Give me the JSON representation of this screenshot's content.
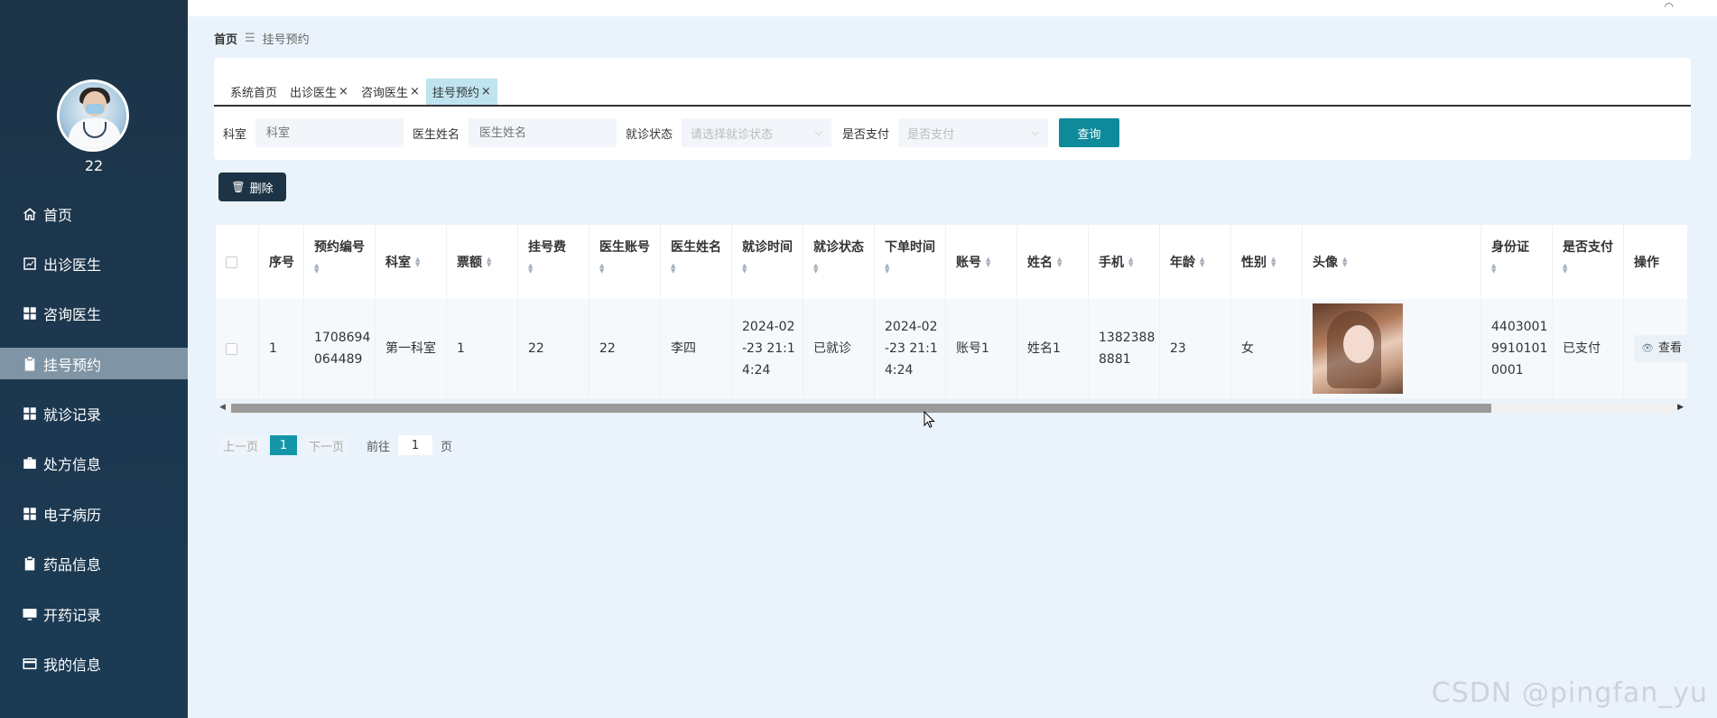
{
  "sidebar": {
    "username": "22",
    "items": [
      {
        "label": "首页",
        "icon": "home-icon"
      },
      {
        "label": "出诊医生",
        "icon": "chart-icon"
      },
      {
        "label": "咨询医生",
        "icon": "grid-icon"
      },
      {
        "label": "挂号预约",
        "icon": "clipboard-icon",
        "active": true
      },
      {
        "label": "就诊记录",
        "icon": "grid-icon"
      },
      {
        "label": "处方信息",
        "icon": "briefcase-icon"
      },
      {
        "label": "电子病历",
        "icon": "grid-icon"
      },
      {
        "label": "药品信息",
        "icon": "clipboard-icon"
      },
      {
        "label": "开药记录",
        "icon": "monitor-icon"
      },
      {
        "label": "我的信息",
        "icon": "card-icon"
      }
    ]
  },
  "breadcrumb": {
    "home": "首页",
    "separator": "☰",
    "current": "挂号预约"
  },
  "tabs": [
    {
      "label": "系统首页",
      "closable": false
    },
    {
      "label": "出诊医生",
      "closable": true
    },
    {
      "label": "咨询医生",
      "closable": true
    },
    {
      "label": "挂号预约",
      "closable": true,
      "active": true
    }
  ],
  "tab_close_glyph": "×",
  "filters": {
    "department_label": "科室",
    "department_placeholder": "科室",
    "doctor_label": "医生姓名",
    "doctor_placeholder": "医生姓名",
    "status_label": "就诊状态",
    "status_placeholder": "请选择就诊状态",
    "paid_label": "是否支付",
    "paid_placeholder": "是否支付",
    "query_button": "查询"
  },
  "delete_button": "删除",
  "table": {
    "headers": [
      "序号",
      "预约编号",
      "科室",
      "票额",
      "挂号费",
      "医生账号",
      "医生姓名",
      "就诊时间",
      "就诊状态",
      "下单时间",
      "账号",
      "姓名",
      "手机",
      "年龄",
      "性别",
      "头像",
      "身份证",
      "是否支付",
      "操作"
    ],
    "rows": [
      {
        "index": "1",
        "appointment_no": "1708694\n064489",
        "department": "第一科室",
        "ticket": "1",
        "fee": "22",
        "doctor_account": "22",
        "doctor_name": "李四",
        "visit_time": "2024-02\n-23 21:1\n4:24",
        "visit_status": "已就诊",
        "order_time": "2024-02\n-23 21:1\n4:24",
        "account": "账号1",
        "name": "姓名1",
        "phone": "1382388\n8881",
        "age": "23",
        "gender": "女",
        "id_card": "4403001\n9910101\n0001",
        "paid": "已支付",
        "action": "查看"
      }
    ]
  },
  "pagination": {
    "prev": "上一页",
    "current": "1",
    "next": "下一页",
    "goto_label": "前往",
    "goto_value": "1",
    "page_suffix": "页"
  },
  "watermark": "CSDN @pingfan_yu",
  "colors": {
    "sidebar": "#1d3448",
    "accent": "#0e8a9a",
    "active_tab": "#bfe4f0",
    "delete_button": "#1c3445"
  }
}
